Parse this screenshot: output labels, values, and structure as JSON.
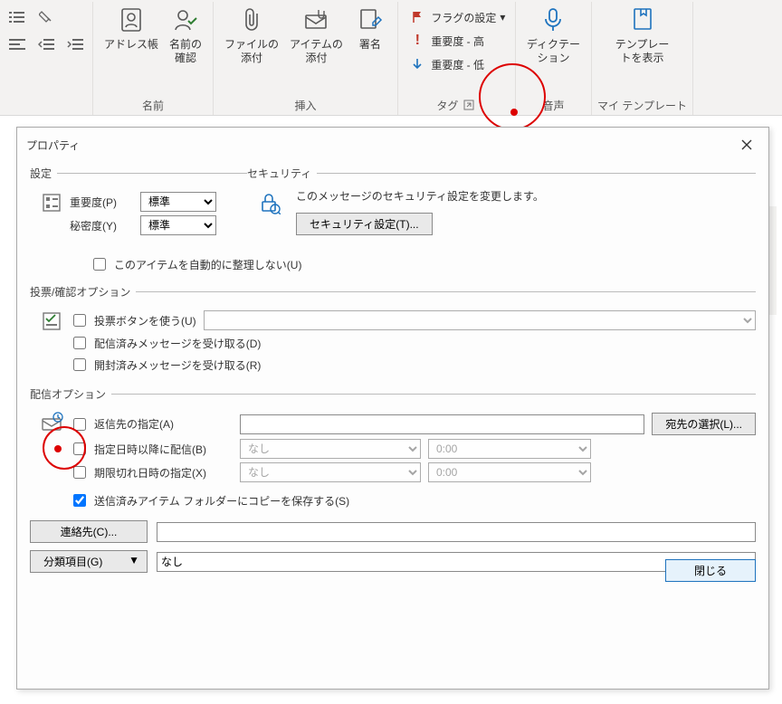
{
  "ribbon": {
    "misc_group": {
      "indent_dec_title": "インデント減",
      "indent_inc_title": "インデント増"
    },
    "names_group": {
      "label": "名前",
      "address_book": "アドレス帳",
      "check_names": "名前の\n確認"
    },
    "insert_group": {
      "label": "挿入",
      "attach_file": "ファイルの\n添付",
      "attach_item": "アイテムの\n添付",
      "signature": "署名"
    },
    "tags_group": {
      "label": "タグ",
      "flag": "フラグの設定",
      "high": "重要度 - 高",
      "low": "重要度 - 低"
    },
    "voice_group": {
      "label": "音声",
      "dictate": "ディクテー\nション"
    },
    "template_group": {
      "label": "マイ テンプレート",
      "show": "テンプレー\nトを表示"
    }
  },
  "dialog": {
    "title": "プロパティ",
    "settings": {
      "legend": "設定",
      "importance_label": "重要度(P)",
      "importance_value": "標準",
      "sensitivity_label": "秘密度(Y)",
      "sensitivity_value": "標準",
      "no_autoarchive": "このアイテムを自動的に整理しない(U)"
    },
    "security": {
      "legend": "セキュリティ",
      "desc": "このメッセージのセキュリティ設定を変更します。",
      "button": "セキュリティ設定(T)..."
    },
    "voting": {
      "legend": "投票/確認オプション",
      "use_voting": "投票ボタンを使う(U)",
      "delivery_receipt": "配信済みメッセージを受け取る(D)",
      "read_receipt": "開封済みメッセージを受け取る(R)"
    },
    "delivery": {
      "legend": "配信オプション",
      "reply_to": "返信先の指定(A)",
      "select_recipients": "宛先の選択(L)...",
      "delay": "指定日時以降に配信(B)",
      "expire": "期限切れ日時の指定(X)",
      "date_none": "なし",
      "time_zero": "0:00",
      "save_sent": "送信済みアイテム フォルダーにコピーを保存する(S)",
      "contacts": "連絡先(C)...",
      "categories": "分類項目(G)",
      "categories_value": "なし"
    },
    "close": "閉じる"
  }
}
